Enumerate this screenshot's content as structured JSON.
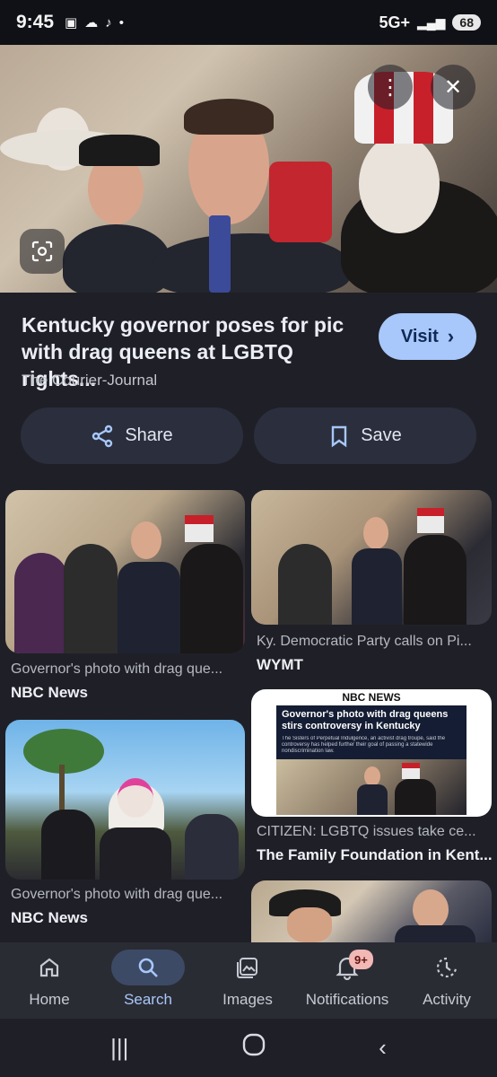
{
  "status": {
    "time": "9:45",
    "network": "5G+",
    "battery": "68"
  },
  "result": {
    "title": "Kentucky governor poses for pic with drag queens at LGBTQ rights...",
    "source": "The Courier-Journal",
    "visit_label": "Visit",
    "share_label": "Share",
    "save_label": "Save"
  },
  "related": [
    {
      "caption": "Governor's photo with drag que...",
      "source": "NBC News"
    },
    {
      "caption": "Ky. Democratic Party calls on Pi...",
      "source": "WYMT"
    },
    {
      "caption": "Governor's photo with drag que...",
      "source": "NBC News"
    },
    {
      "caption": "CITIZEN: LGBTQ issues take ce...",
      "source": "The Family Foundation in Kent...",
      "thumb_brand": "NBC NEWS",
      "thumb_headline": "Governor's photo with drag queens stirs controversy in Kentucky",
      "thumb_body": "The Sisters of Perpetual Indulgence, an activist drag troupe, said the controversy has helped further their goal of passing a statewide nondiscrimination law."
    }
  ],
  "nav": {
    "home": "Home",
    "search": "Search",
    "images": "Images",
    "notifications": "Notifications",
    "notifications_badge": "9+",
    "activity": "Activity"
  },
  "colors": {
    "accent": "#a8c7fa",
    "background": "#1f2027",
    "badge": "#f2b8b5"
  }
}
